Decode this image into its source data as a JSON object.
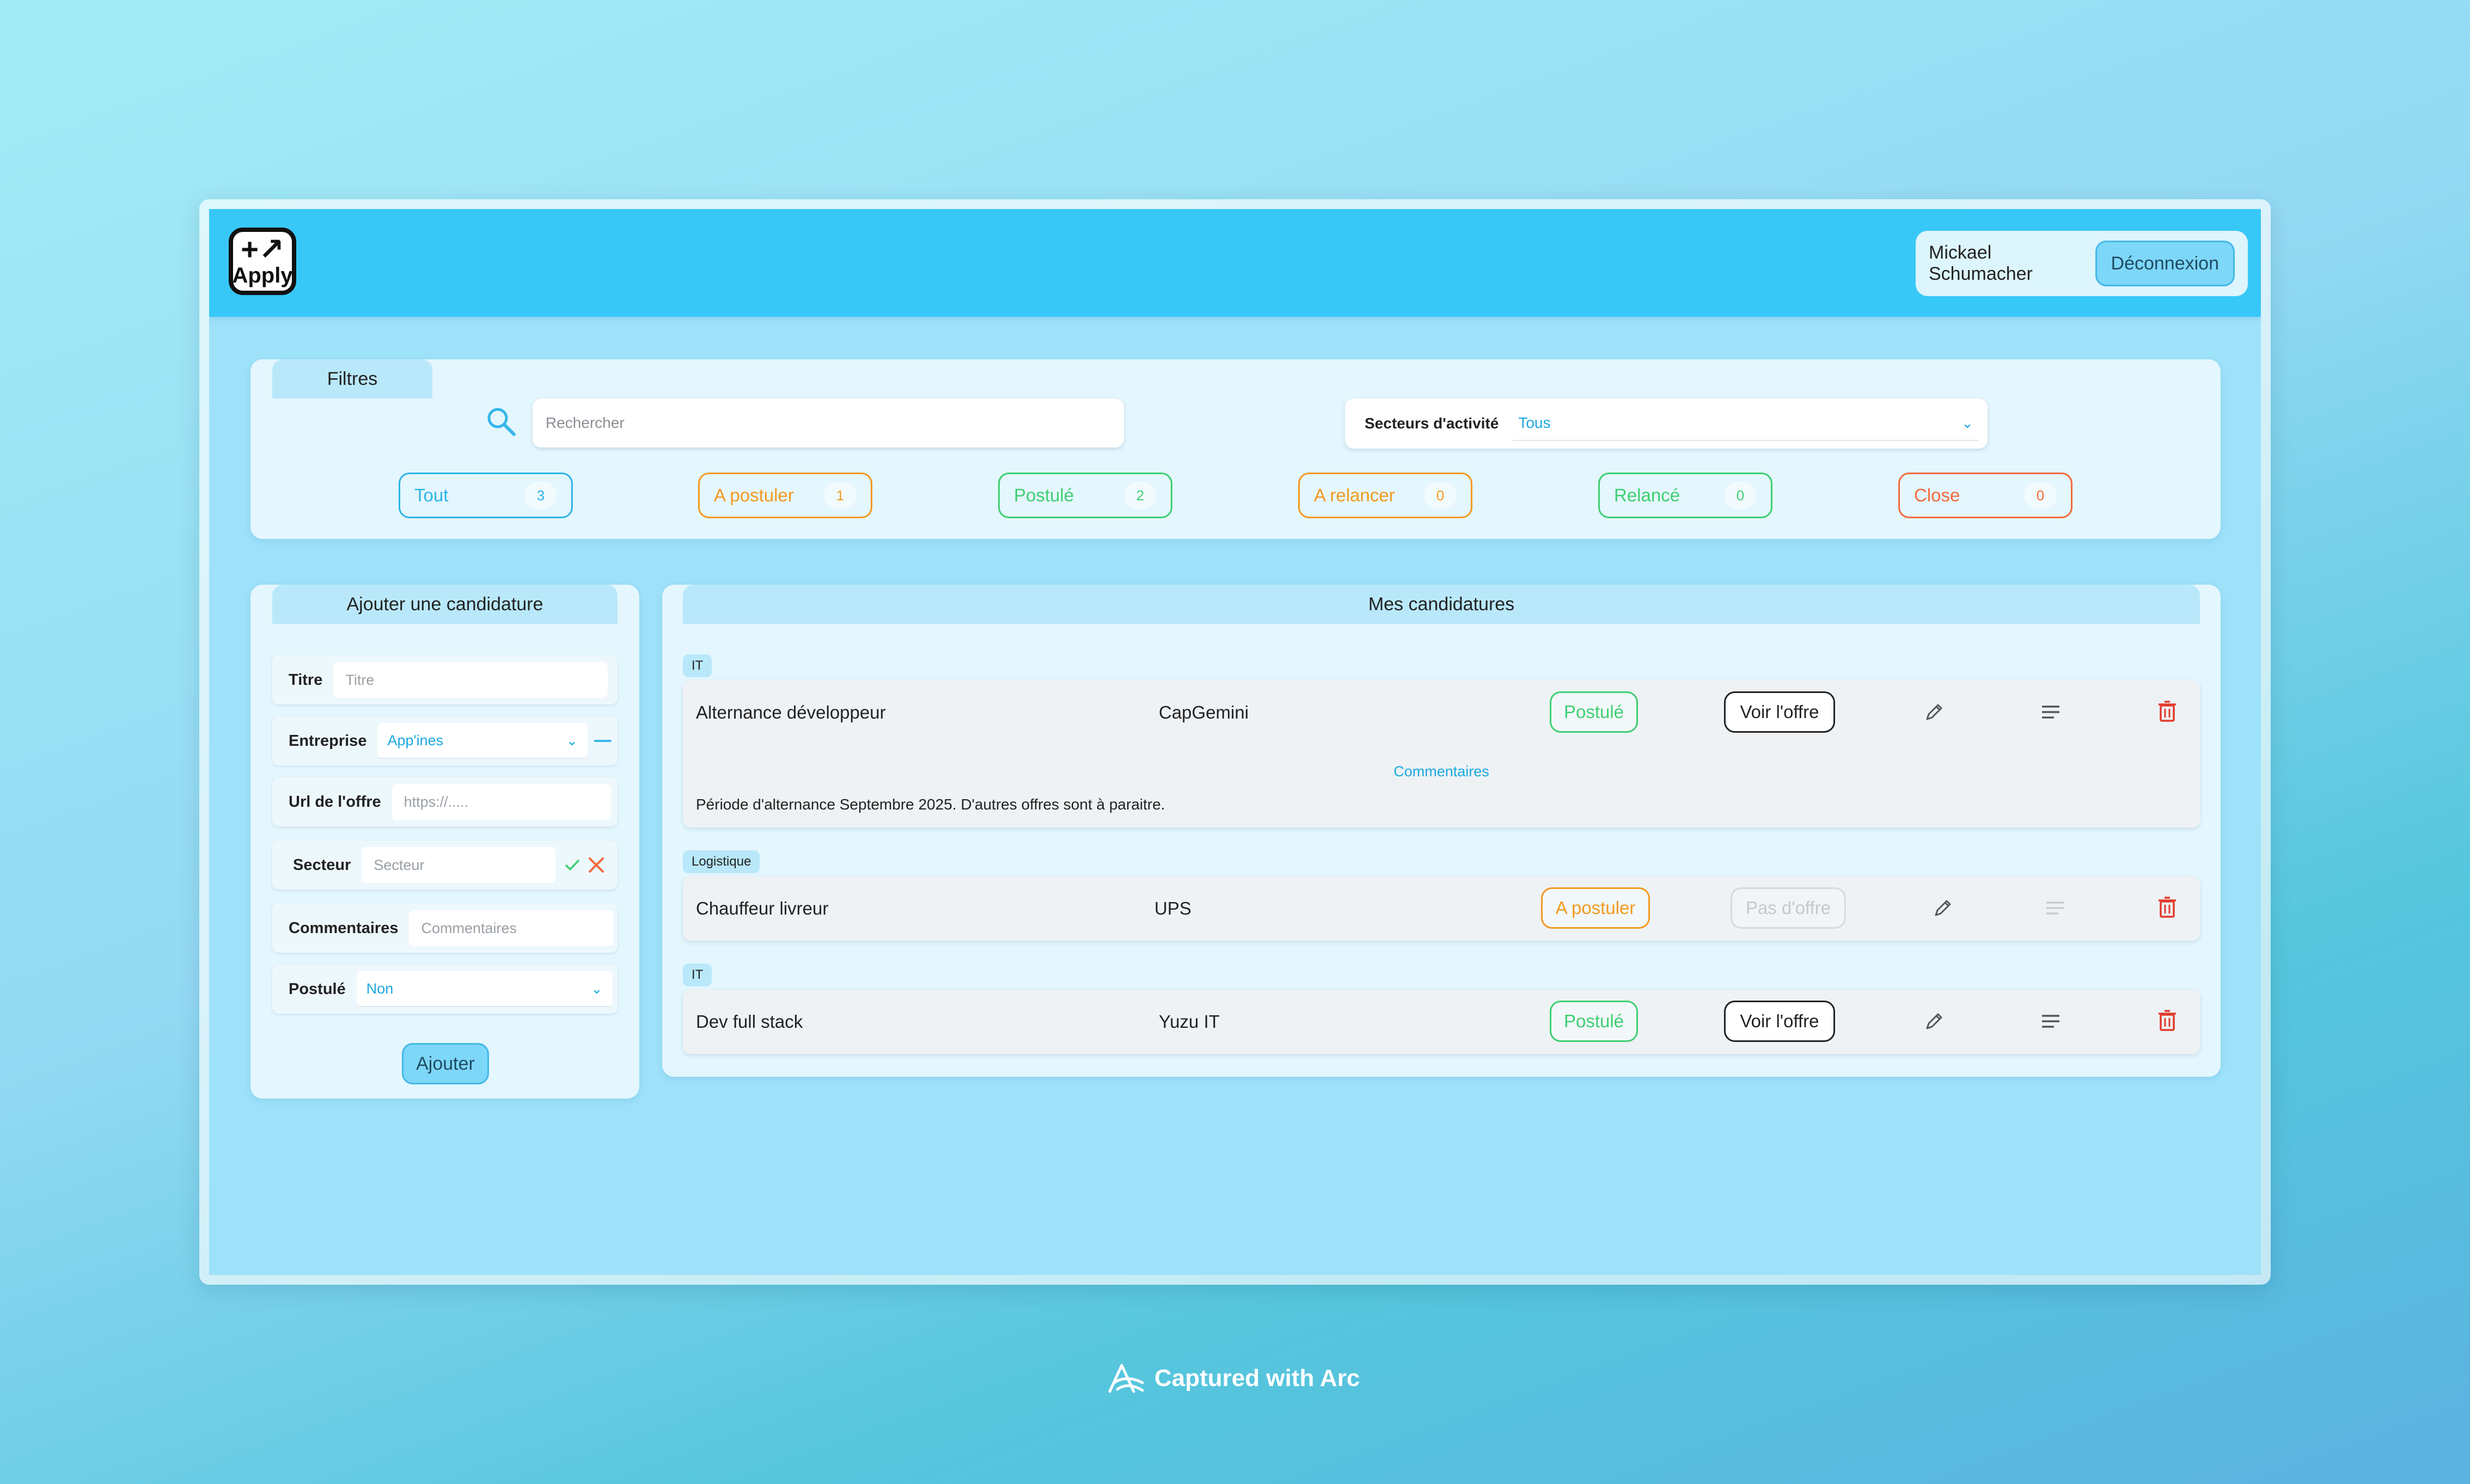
{
  "header": {
    "logo_text": "Apply",
    "logo_mark": "+↗",
    "user_name": "Mickael Schumacher",
    "logout_label": "Déconnexion"
  },
  "filters": {
    "tab_label": "Filtres",
    "search_placeholder": "Rechercher",
    "sector_label": "Secteurs d'activité",
    "sector_value": "Tous",
    "chips": [
      {
        "label": "Tout",
        "count": "3",
        "color": "#2db5e6"
      },
      {
        "label": "A postuler",
        "count": "1",
        "color": "#f39a1f"
      },
      {
        "label": "Postulé",
        "count": "2",
        "color": "#3fcf72"
      },
      {
        "label": "A relancer",
        "count": "0",
        "color": "#f39a1f"
      },
      {
        "label": "Relancé",
        "count": "0",
        "color": "#3fcf72"
      },
      {
        "label": "Close",
        "count": "0",
        "color": "#f36a3c"
      }
    ]
  },
  "add_form": {
    "title": "Ajouter une candidature",
    "titre_label": "Titre",
    "titre_placeholder": "Titre",
    "entreprise_label": "Entreprise",
    "entreprise_value": "App'ines",
    "url_label": "Url de l'offre",
    "url_placeholder": "https://.....",
    "secteur_label": "Secteur",
    "secteur_placeholder": "Secteur",
    "commentaires_label": "Commentaires",
    "commentaires_placeholder": "Commentaires",
    "postule_label": "Postulé",
    "postule_value": "Non",
    "submit_label": "Ajouter"
  },
  "applications": {
    "title": "Mes candidatures",
    "comments_label": "Commentaires",
    "items": [
      {
        "sector": "IT",
        "title": "Alternance développeur",
        "company": "CapGemini",
        "status": "Postulé",
        "status_color": "#3fcf72",
        "offer_label": "Voir l'offre",
        "comment": "Période d'alternance Septembre 2025. D'autres offres sont à paraitre."
      },
      {
        "sector": "Logistique",
        "title": "Chauffeur livreur",
        "company": "UPS",
        "status": "A postuler",
        "status_color": "#f39a1f",
        "offer_label": "Pas d'offre"
      },
      {
        "sector": "IT",
        "title": "Dev full stack",
        "company": "Yuzu IT",
        "status": "Postulé",
        "status_color": "#3fcf72",
        "offer_label": "Voir l'offre"
      }
    ]
  },
  "footer": {
    "capture_text": "Captured with Arc"
  }
}
